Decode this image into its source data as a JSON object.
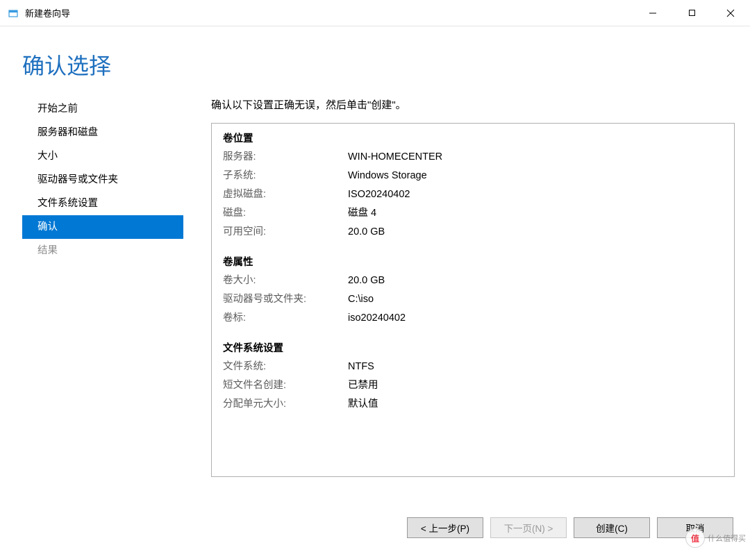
{
  "window": {
    "title": "新建卷向导"
  },
  "header": {
    "title": "确认选择"
  },
  "sidebar": {
    "items": [
      {
        "label": "开始之前",
        "state": "normal"
      },
      {
        "label": "服务器和磁盘",
        "state": "normal"
      },
      {
        "label": "大小",
        "state": "normal"
      },
      {
        "label": "驱动器号或文件夹",
        "state": "normal"
      },
      {
        "label": "文件系统设置",
        "state": "normal"
      },
      {
        "label": "确认",
        "state": "active"
      },
      {
        "label": "结果",
        "state": "disabled"
      }
    ]
  },
  "content": {
    "instruction": "确认以下设置正确无误，然后单击\"创建\"。",
    "sections": {
      "location": {
        "title": "卷位置",
        "server_label": "服务器:",
        "server_value": "WIN-HOMECENTER",
        "subsystem_label": "子系统:",
        "subsystem_value": "Windows Storage",
        "vdisk_label": "虚拟磁盘:",
        "vdisk_value": "ISO20240402",
        "disk_label": "磁盘:",
        "disk_value": "磁盘 4",
        "free_label": "可用空间:",
        "free_value": "20.0 GB"
      },
      "props": {
        "title": "卷属性",
        "size_label": "卷大小:",
        "size_value": "20.0 GB",
        "drive_label": "驱动器号或文件夹:",
        "drive_value": "C:\\iso",
        "vlabel_label": "卷标:",
        "vlabel_value": "iso20240402"
      },
      "fs": {
        "title": "文件系统设置",
        "fs_label": "文件系统:",
        "fs_value": "NTFS",
        "shortname_label": "短文件名创建:",
        "shortname_value": "已禁用",
        "au_label": "分配单元大小:",
        "au_value": "默认值"
      }
    }
  },
  "footer": {
    "previous": "< 上一步(P)",
    "next": "下一页(N) >",
    "create": "创建(C)",
    "cancel": "取消"
  },
  "watermark": {
    "badge": "值",
    "text": "什么值得买"
  }
}
